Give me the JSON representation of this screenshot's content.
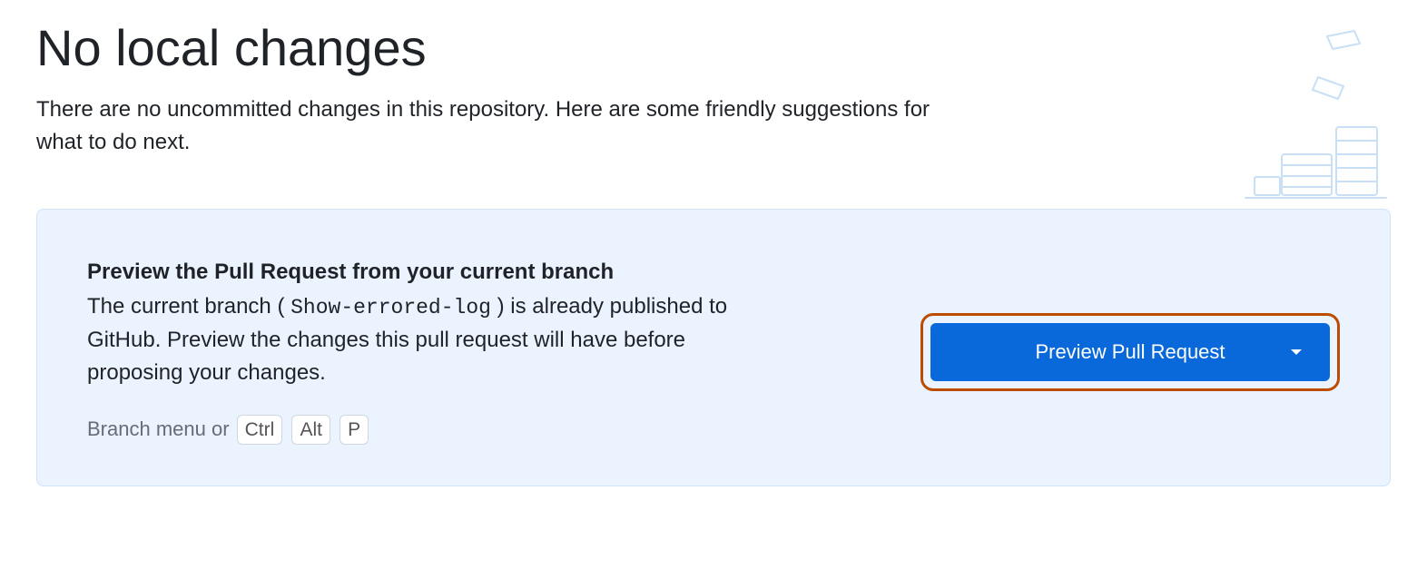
{
  "header": {
    "title": "No local changes",
    "subtitle": "There are no uncommitted changes in this repository. Here are some friendly suggestions for what to do next."
  },
  "card": {
    "title": "Preview the Pull Request from your current branch",
    "desc_prefix": "The current branch (",
    "branch_name": "Show-errored-log",
    "desc_suffix": ") is already published to GitHub. Preview the changes this pull request will have before proposing your changes.",
    "hint_prefix": "Branch menu or ",
    "keys": [
      "Ctrl",
      "Alt",
      "P"
    ],
    "button_label": "Preview Pull Request"
  },
  "colors": {
    "accent": "#0969da",
    "highlight": "#bc4c00",
    "card_bg": "#eaf3fe"
  }
}
